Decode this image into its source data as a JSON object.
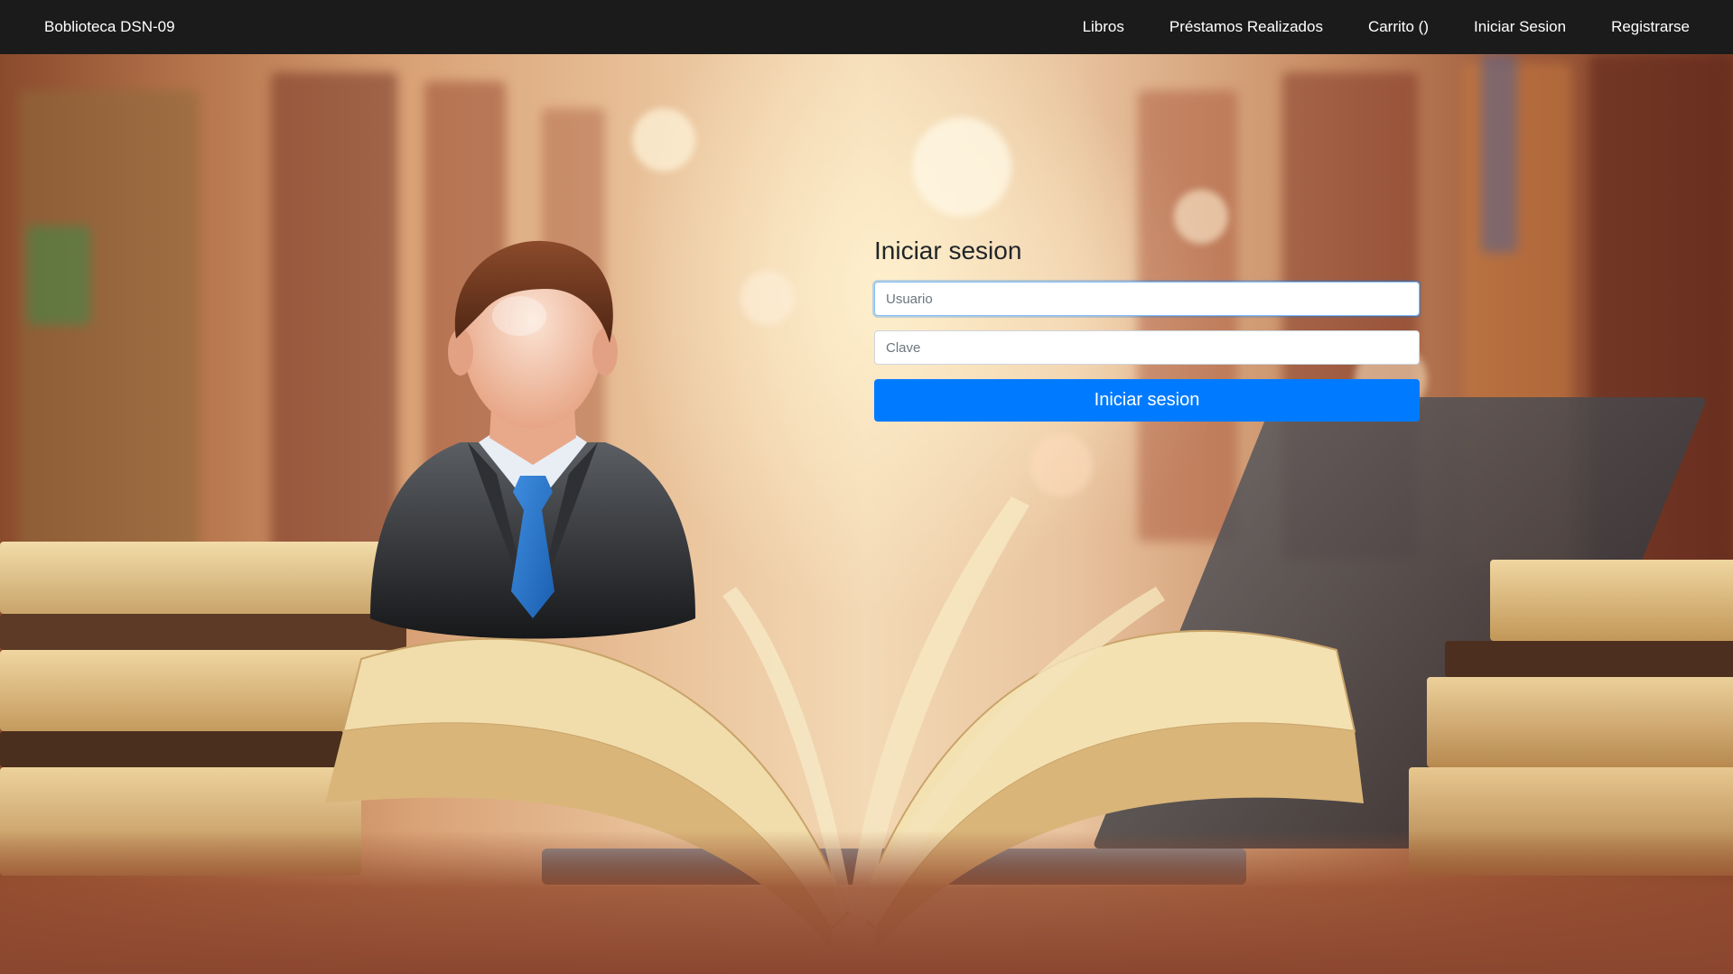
{
  "navbar": {
    "brand": "Boblioteca DSN-09",
    "links": [
      {
        "label": "Libros"
      },
      {
        "label": "Préstamos Realizados"
      },
      {
        "label": "Carrito ()"
      },
      {
        "label": "Iniciar Sesion"
      },
      {
        "label": "Registrarse"
      }
    ]
  },
  "login": {
    "title": "Iniciar sesion",
    "username": {
      "placeholder": "Usuario",
      "value": ""
    },
    "password": {
      "placeholder": "Clave",
      "value": ""
    },
    "submit_label": "Iniciar sesion"
  },
  "theme": {
    "navbar_bg": "#1b1b1b",
    "primary": "#007bff",
    "text": "#212529"
  },
  "icons": {
    "avatar": "user-avatar-icon"
  }
}
